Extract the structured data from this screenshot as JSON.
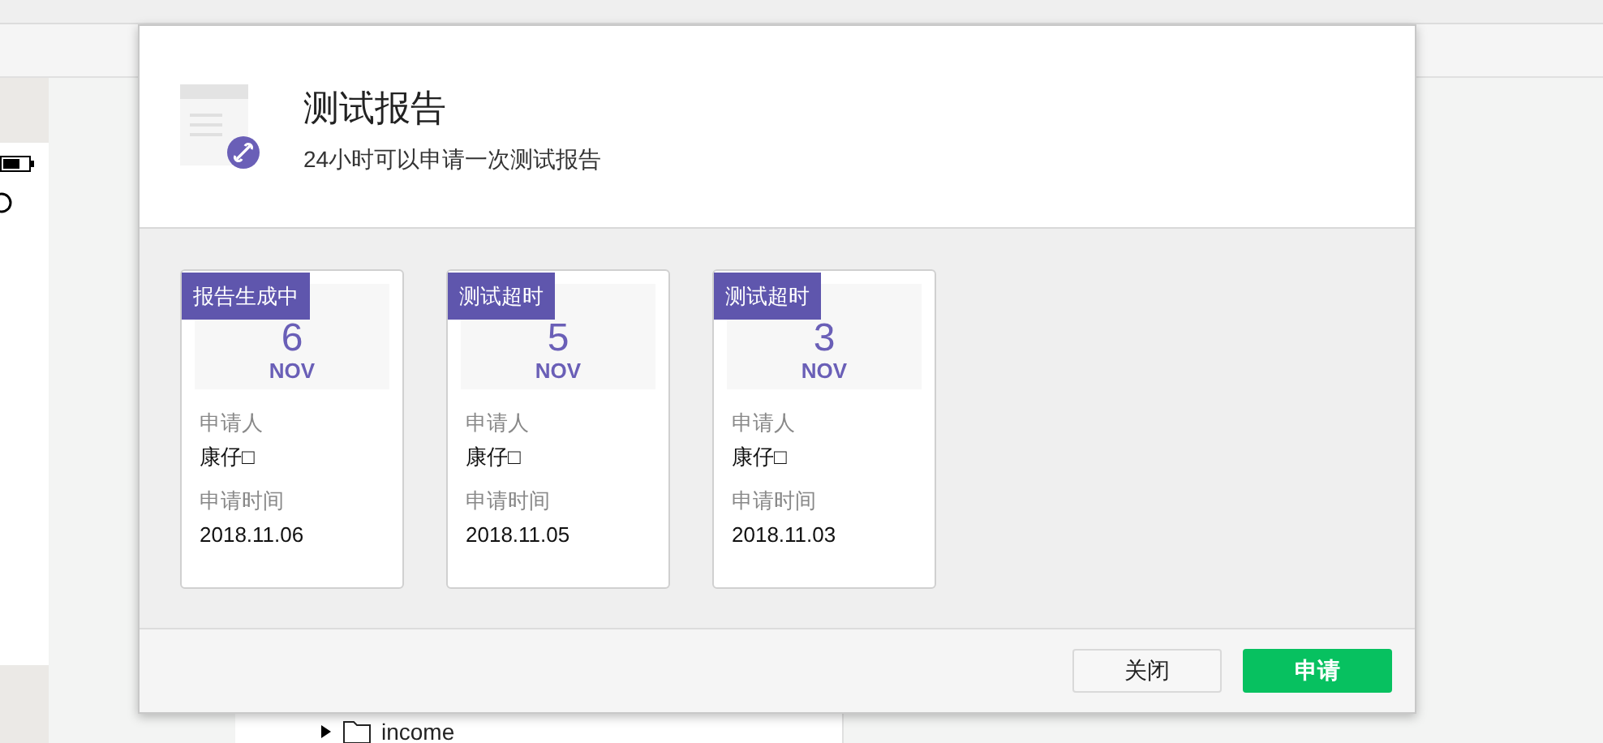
{
  "dialog": {
    "title": "测试报告",
    "subtitle": "24小时可以申请一次测试报告",
    "reports": [
      {
        "status": "报告生成中",
        "day": "6",
        "month": "NOV",
        "applicant_label": "申请人",
        "applicant": "康仔□",
        "time_label": "申请时间",
        "time": "2018.11.06"
      },
      {
        "status": "测试超时",
        "day": "5",
        "month": "NOV",
        "applicant_label": "申请人",
        "applicant": "康仔□",
        "time_label": "申请时间",
        "time": "2018.11.05"
      },
      {
        "status": "测试超时",
        "day": "3",
        "month": "NOV",
        "applicant_label": "申请人",
        "applicant": "康仔□",
        "time_label": "申请时间",
        "time": "2018.11.03"
      }
    ],
    "buttons": [
      {
        "label": "关闭",
        "kind": "secondary"
      },
      {
        "label": "申请",
        "kind": "primary"
      }
    ]
  },
  "file_tree": {
    "items": [
      {
        "label": "income",
        "expanded": false
      }
    ]
  }
}
